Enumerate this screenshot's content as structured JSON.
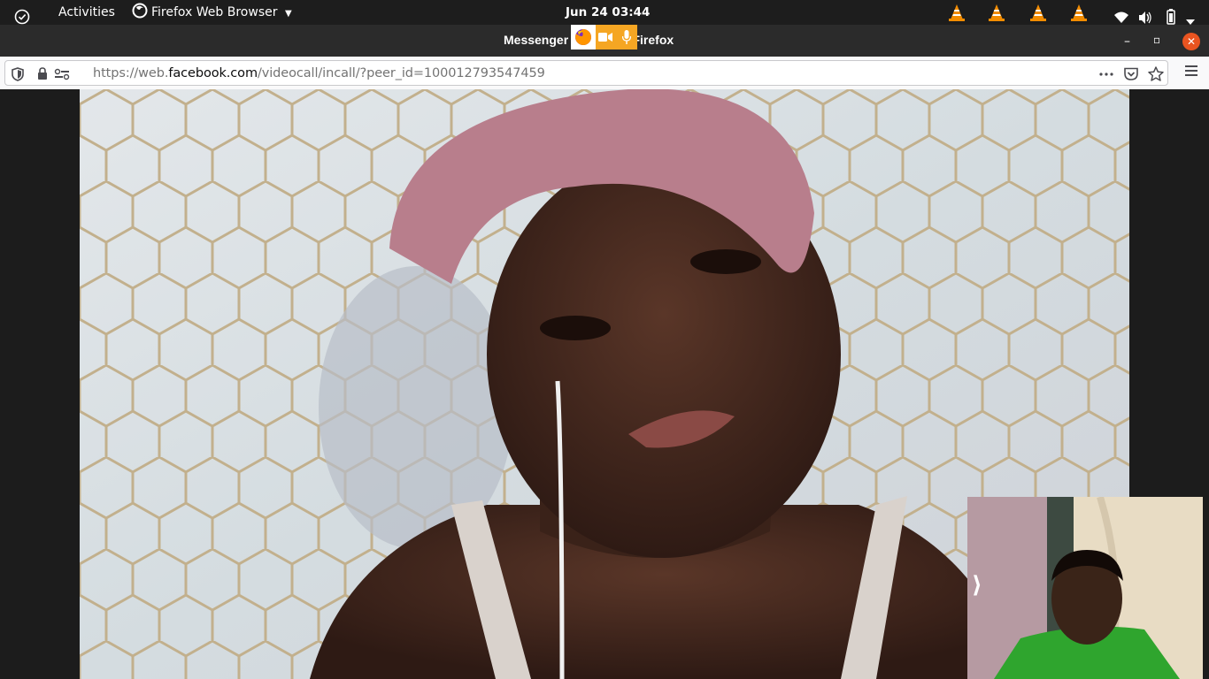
{
  "topbar": {
    "activities": "Activities",
    "app_menu": "Firefox Web Browser",
    "clock": "Jun 24  03:44",
    "tray_icons": [
      "vlc-cone-icon",
      "vlc-cone-icon",
      "vlc-cone-icon",
      "vlc-cone-icon",
      "network-icon",
      "volume-icon",
      "battery-icon",
      "caret-down-icon"
    ]
  },
  "window": {
    "title": "Messenger — Mozilla Firefox",
    "sharing_indicator": [
      "firefox-icon",
      "camera-icon",
      "microphone-icon"
    ],
    "controls": {
      "minimize": "–",
      "maximize": "▫",
      "close": "✕"
    }
  },
  "navbar": {
    "url_prefix": "https://web.",
    "url_domain": "facebook.com",
    "url_suffix": "/videocall/incall/?peer_id=100012793547459",
    "icons": [
      "shield-icon",
      "lock-icon",
      "permissions-icon",
      "page-actions-icon",
      "pocket-icon",
      "bookmark-star-icon",
      "hamburger-menu-icon"
    ]
  },
  "call": {
    "collapse_label": "⟩"
  },
  "colors": {
    "topbar": "#1d1d1d",
    "titlebar": "#2b2b2b",
    "sharing_indicator": "#f5a623",
    "close_button": "#e95420"
  }
}
